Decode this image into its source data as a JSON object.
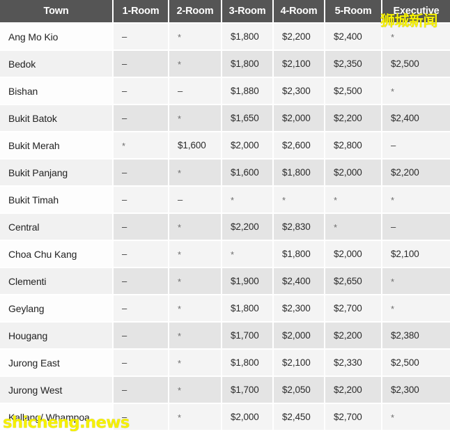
{
  "table": {
    "columns": [
      "Town",
      "1-Room",
      "2-Room",
      "3-Room",
      "4-Room",
      "5-Room",
      "Executive"
    ],
    "rows": [
      {
        "town": "Ang Mo Kio",
        "r1": "–",
        "r2": "*",
        "r3": "$1,800",
        "r4": "$2,200",
        "r5": "$2,400",
        "exec": "*"
      },
      {
        "town": "Bedok",
        "r1": "–",
        "r2": "*",
        "r3": "$1,800",
        "r4": "$2,100",
        "r5": "$2,350",
        "exec": "$2,500"
      },
      {
        "town": "Bishan",
        "r1": "–",
        "r2": "–",
        "r3": "$1,880",
        "r4": "$2,300",
        "r5": "$2,500",
        "exec": "*"
      },
      {
        "town": "Bukit Batok",
        "r1": "–",
        "r2": "*",
        "r3": "$1,650",
        "r4": "$2,000",
        "r5": "$2,200",
        "exec": "$2,400"
      },
      {
        "town": "Bukit Merah",
        "r1": "*",
        "r2": "$1,600",
        "r3": "$2,000",
        "r4": "$2,600",
        "r5": "$2,800",
        "exec": "–"
      },
      {
        "town": "Bukit Panjang",
        "r1": "–",
        "r2": "*",
        "r3": "$1,600",
        "r4": "$1,800",
        "r5": "$2,000",
        "exec": "$2,200"
      },
      {
        "town": "Bukit Timah",
        "r1": "–",
        "r2": "–",
        "r3": "*",
        "r4": "*",
        "r5": "*",
        "exec": "*"
      },
      {
        "town": "Central",
        "r1": "–",
        "r2": "*",
        "r3": "$2,200",
        "r4": "$2,830",
        "r5": "*",
        "exec": "–"
      },
      {
        "town": "Choa Chu Kang",
        "r1": "–",
        "r2": "*",
        "r3": "*",
        "r4": "$1,800",
        "r5": "$2,000",
        "exec": "$2,100"
      },
      {
        "town": "Clementi",
        "r1": "–",
        "r2": "*",
        "r3": "$1,900",
        "r4": "$2,400",
        "r5": "$2,650",
        "exec": "*"
      },
      {
        "town": "Geylang",
        "r1": "–",
        "r2": "*",
        "r3": "$1,800",
        "r4": "$2,300",
        "r5": "$2,700",
        "exec": "*"
      },
      {
        "town": "Hougang",
        "r1": "–",
        "r2": "*",
        "r3": "$1,700",
        "r4": "$2,000",
        "r5": "$2,200",
        "exec": "$2,380"
      },
      {
        "town": "Jurong East",
        "r1": "–",
        "r2": "*",
        "r3": "$1,800",
        "r4": "$2,100",
        "r5": "$2,330",
        "exec": "$2,500"
      },
      {
        "town": "Jurong West",
        "r1": "–",
        "r2": "*",
        "r3": "$1,700",
        "r4": "$2,050",
        "r5": "$2,200",
        "exec": "$2,300"
      },
      {
        "town": "Kallang/ Whampoa",
        "r1": "–",
        "r2": "*",
        "r3": "$2,000",
        "r4": "$2,450",
        "r5": "$2,700",
        "exec": "*"
      }
    ]
  },
  "watermarks": {
    "chinese": "狮城新闻",
    "url": "shicheng.news",
    "color": "#f5f000"
  },
  "colors": {
    "header_bg": "#555555",
    "header_text": "#ffffff",
    "row_light": "#f4f4f4",
    "row_dark": "#e4e4e4",
    "town_light": "#fdfdfd",
    "town_dark": "#f1f1f1",
    "cell_text": "#2b2b2b",
    "grid_line": "#ffffff"
  }
}
